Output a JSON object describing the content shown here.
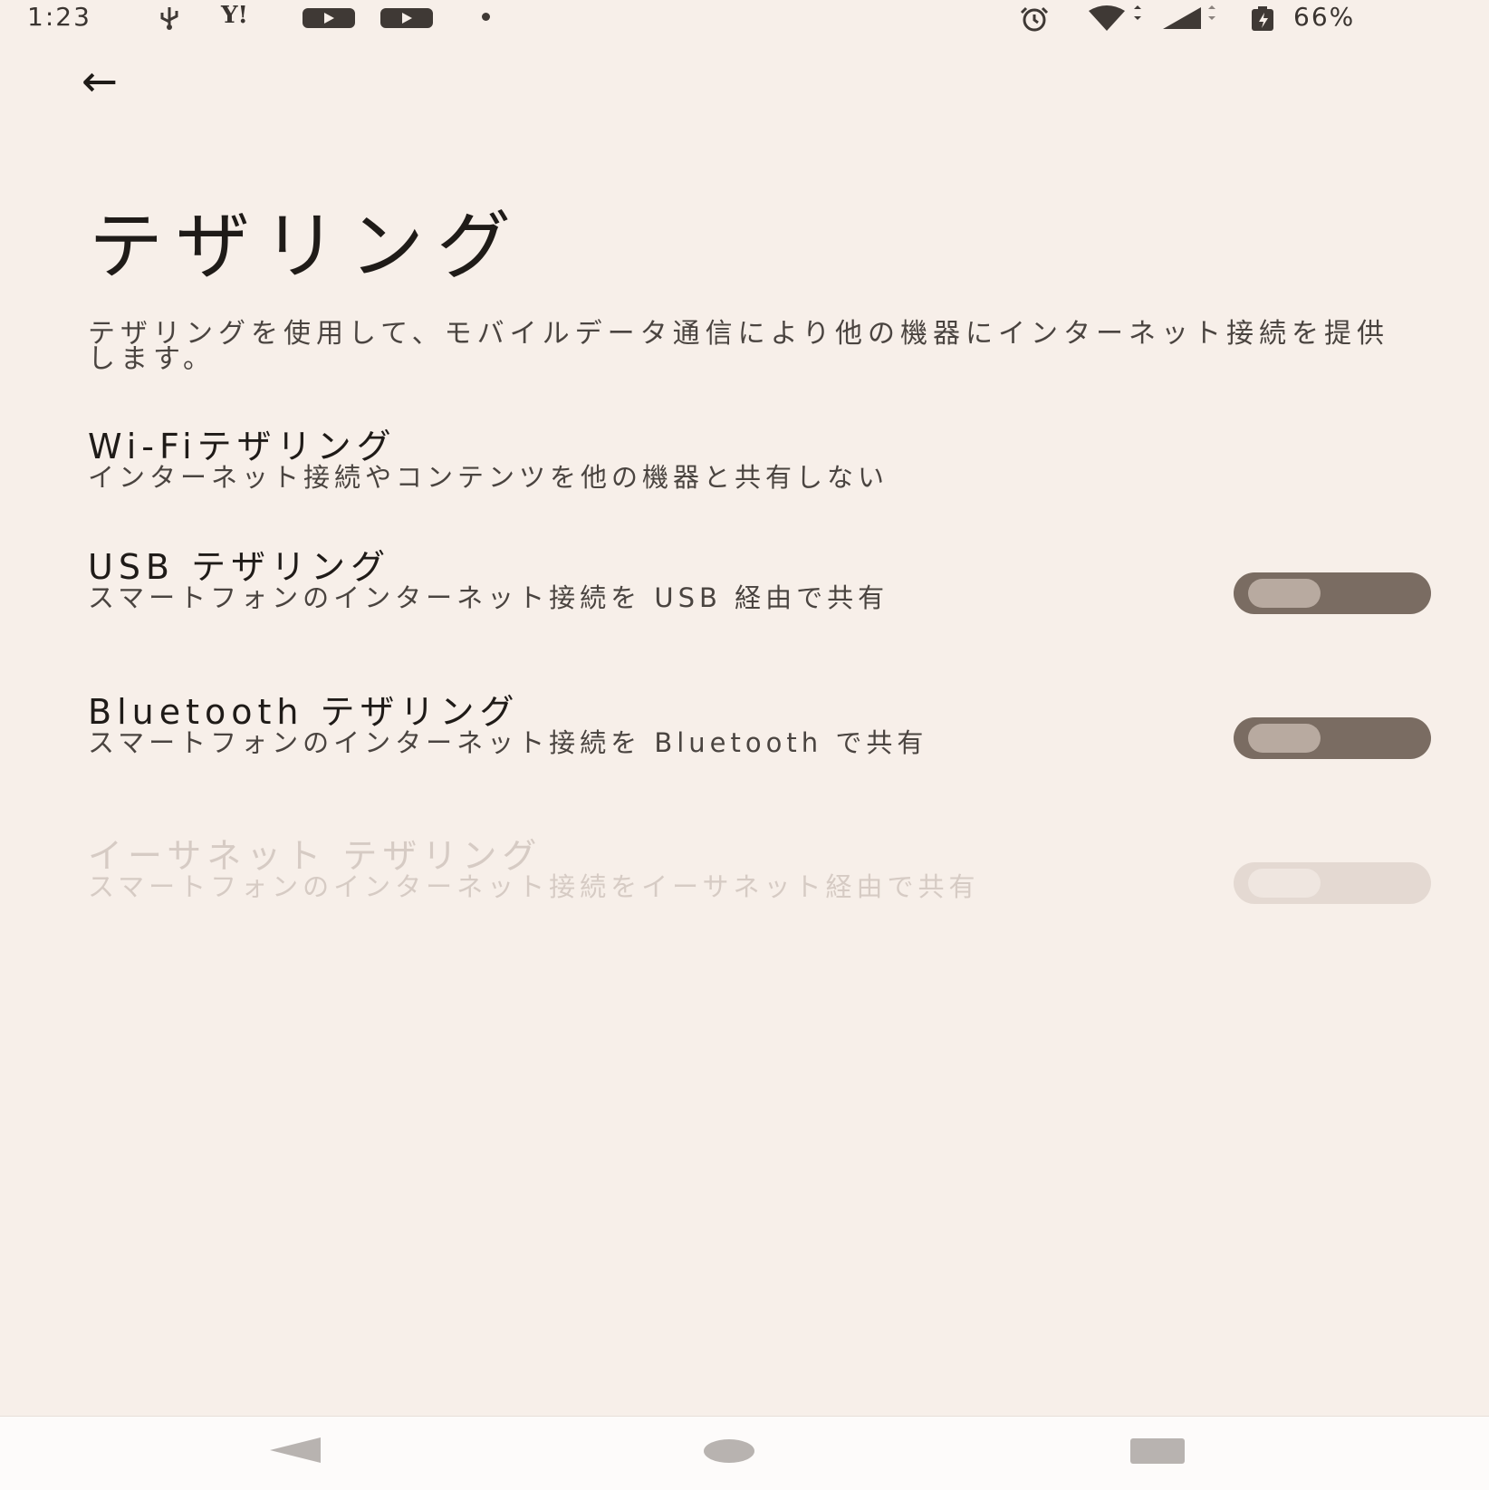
{
  "status_bar": {
    "time": "1:23",
    "icons": [
      "usb-icon",
      "yahoo-icon",
      "youtube-icon",
      "youtube-icon",
      "dot-icon",
      "alarm-icon",
      "wifi-icon",
      "signal-icon",
      "battery-icon"
    ],
    "yahoo_glyph": "Y!",
    "battery": "66%"
  },
  "header": {
    "back_icon": "←",
    "title": "テザリング"
  },
  "description": "テザリングを使用して、モバイルデータ通信により他の機器にインターネット接続を提供します。",
  "items": [
    {
      "title": "Wi-Fiテザリング",
      "subtitle": "インターネット接続やコンテンツを他の機器と共有しない"
    },
    {
      "title": "USB テザリング",
      "subtitle": "スマートフォンのインターネット接続を USB 経由で共有",
      "toggle": "off"
    },
    {
      "title": "Bluetooth テザリング",
      "subtitle": "スマートフォンのインターネット接続を Bluetooth で共有",
      "toggle": "off"
    },
    {
      "title": "イーサネット テザリング",
      "subtitle": "スマートフォンのインターネット接続をイーサネット経由で共有",
      "toggle": "off",
      "disabled": true
    }
  ],
  "nav": {
    "icons": [
      "nav-back-icon",
      "nav-home-icon",
      "nav-recents-icon"
    ]
  }
}
